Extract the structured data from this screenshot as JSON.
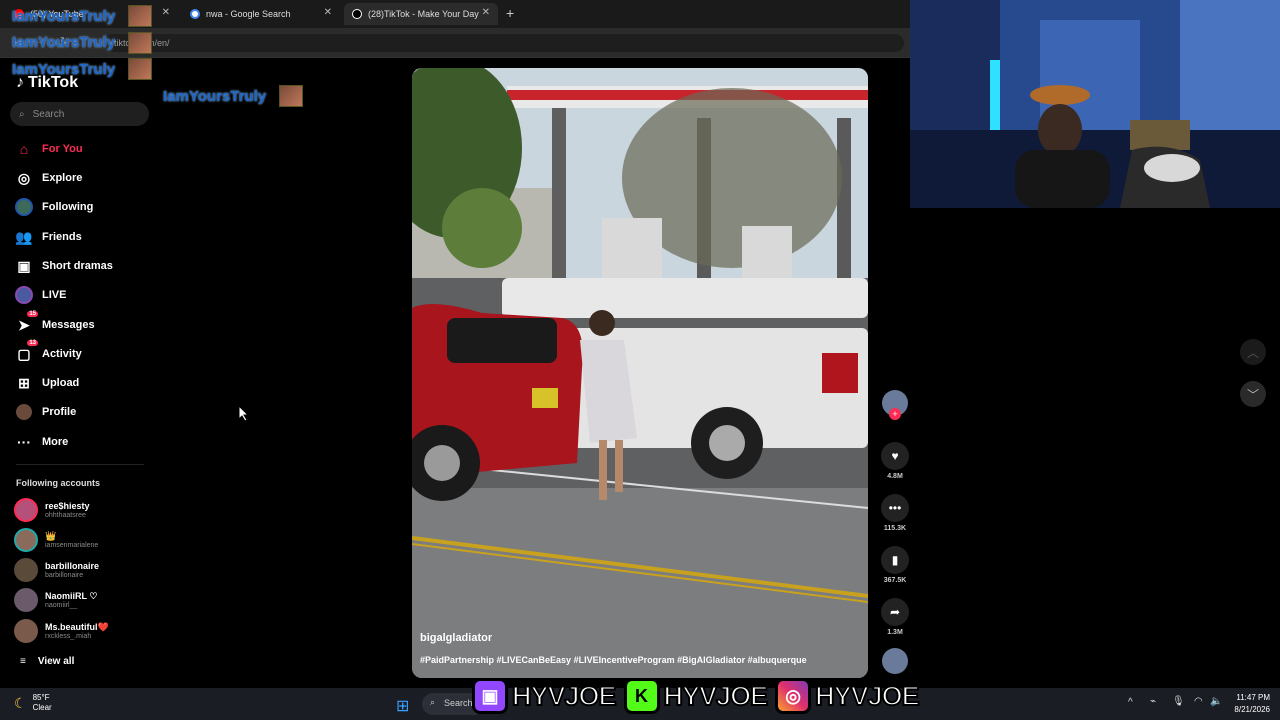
{
  "browser": {
    "tabs": [
      {
        "title": "(50) YouTube",
        "favicon_color": "#ff0000"
      },
      {
        "title": "nwa - Google Search",
        "favicon_color": "#4285f4"
      },
      {
        "title": "(28)TikTok - Make Your Day",
        "favicon_color": "#ffffff"
      }
    ],
    "url": "tiktok.com/en/"
  },
  "watermark": {
    "name": "IamYoursTruly"
  },
  "tiktok": {
    "logo": "TikTok",
    "search_placeholder": "Search",
    "nav": [
      {
        "label": "For You",
        "icon": "home-icon",
        "active": true
      },
      {
        "label": "Explore",
        "icon": "compass-icon"
      },
      {
        "label": "Following",
        "icon": "following-avatar-icon"
      },
      {
        "label": "Friends",
        "icon": "friends-icon"
      },
      {
        "label": "Short dramas",
        "icon": "film-icon"
      },
      {
        "label": "LIVE",
        "icon": "live-avatar-icon"
      },
      {
        "label": "Messages",
        "icon": "messages-icon",
        "badge": "15"
      },
      {
        "label": "Activity",
        "icon": "activity-icon",
        "badge": "13"
      },
      {
        "label": "Upload",
        "icon": "upload-icon"
      },
      {
        "label": "Profile",
        "icon": "profile-avatar-icon"
      },
      {
        "label": "More",
        "icon": "more-icon"
      }
    ],
    "following_heading": "Following accounts",
    "accounts": [
      {
        "name": "ree$hiesty",
        "handle": "ohhthaatsree",
        "color": "#b5507a"
      },
      {
        "name": "👑",
        "handle": "iamsenmarialene",
        "color": "#8a6a5a"
      },
      {
        "name": "barbillonaire",
        "handle": "barbillonaire",
        "color": "#5a4a3a"
      },
      {
        "name": "NaomiiRL ♡",
        "handle": "naomiirl__",
        "color": "#6a5a6a"
      },
      {
        "name": "Ms.beautiful❤️",
        "handle": "rxckless_.miah",
        "color": "#7a5a4a"
      }
    ],
    "view_all": "View all"
  },
  "video": {
    "username": "bigalgladiator",
    "caption": "#PaidPartnership #LIVECanBeEasy #LIVEIncentiveProgram #BigAlGladiator #albuquerque",
    "likes": "4.8M",
    "comments": "115.3K",
    "saves": "367.5K",
    "shares": "1.3M"
  },
  "taskbar": {
    "temperature": "85°F",
    "condition": "Clear",
    "search": "Search",
    "time": "11:47 PM",
    "date": "8/21/2026"
  },
  "banner": {
    "handle": "HYVJOE"
  }
}
